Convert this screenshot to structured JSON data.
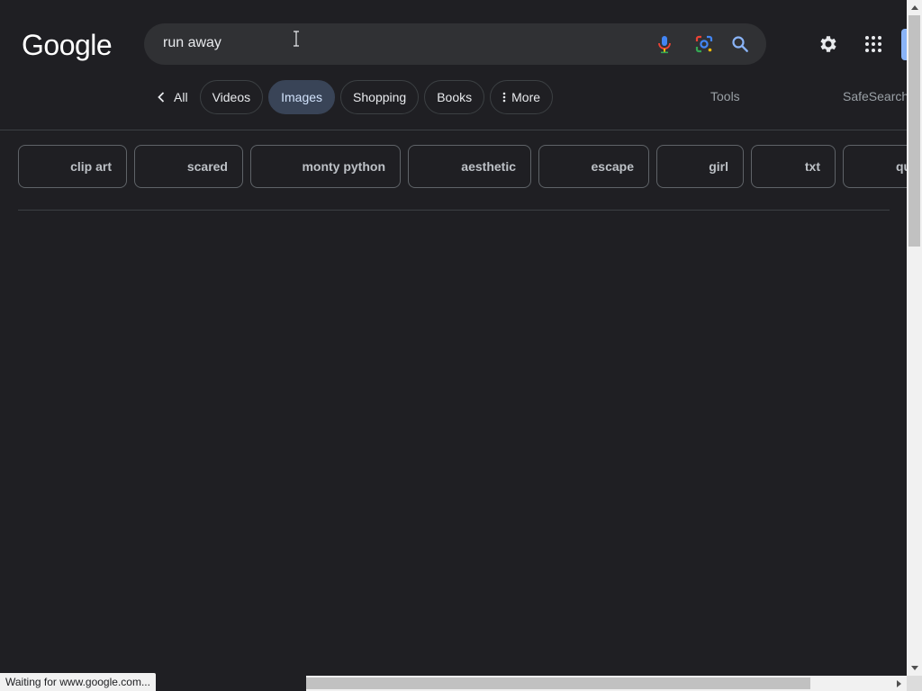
{
  "logo": {
    "text": "Google"
  },
  "search": {
    "query": "run away",
    "icons": [
      "mic-icon",
      "google-lens-icon",
      "search-icon"
    ]
  },
  "header": {
    "icons": [
      "gear-icon",
      "apps-grid-icon"
    ]
  },
  "tabs": [
    {
      "label": "All",
      "icon": "chevron-left-icon",
      "active": false
    },
    {
      "label": "Videos",
      "active": false
    },
    {
      "label": "Images",
      "active": true
    },
    {
      "label": "Shopping",
      "active": false
    },
    {
      "label": "Books",
      "active": false
    },
    {
      "label": "More",
      "icon": "vertical-dots-icon",
      "active": false
    }
  ],
  "toolbar": {
    "tools_label": "Tools",
    "safesearch_label": "SafeSearch"
  },
  "chips": [
    "clip art",
    "scared",
    "monty python",
    "aesthetic",
    "escape",
    "girl",
    "txt",
    "qu"
  ],
  "status_bar": {
    "text": "Waiting for www.google.com..."
  },
  "colors": {
    "background": "#1f1f23",
    "searchbox": "#303134",
    "active_tab": "#394457",
    "accent_blue": "#8ab4f8"
  }
}
